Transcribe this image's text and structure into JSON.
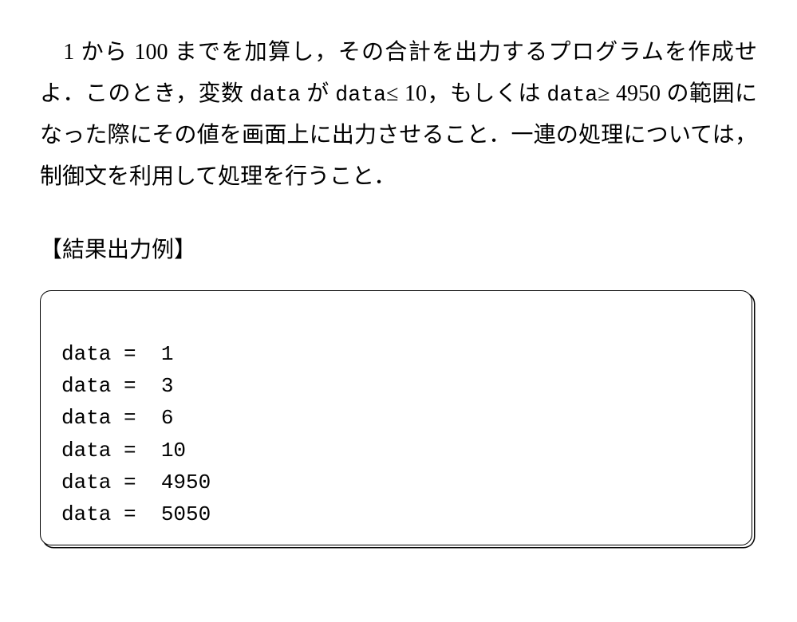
{
  "problem": {
    "part1_prefix": "　1 から 100 までを加算し，その合計を出力するプログラムを作成せよ．このとき，変数 ",
    "code1": "data",
    "part2": " が ",
    "code2": "data",
    "part3": "≤ 10，もしくは ",
    "code3": "data",
    "part4": "≥ 4950 の範囲になった際にその値を画面上に出力させること．一連の処理については，制御文を利用して処理を行うこと．"
  },
  "example_label": "【結果出力例】",
  "output_lines": [
    "data =  1",
    "data =  3",
    "data =  6",
    "data =  10",
    "data =  4950",
    "data =  5050"
  ]
}
